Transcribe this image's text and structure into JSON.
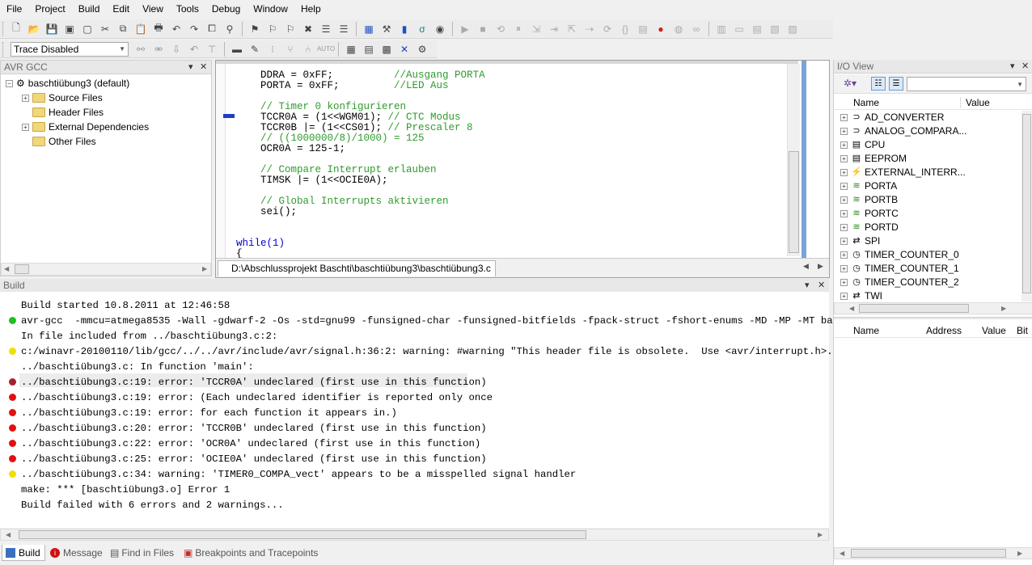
{
  "menu": [
    "File",
    "Project",
    "Build",
    "Edit",
    "View",
    "Tools",
    "Debug",
    "Window",
    "Help"
  ],
  "toolbar2": {
    "trace_combo": "Trace Disabled"
  },
  "left_panel": {
    "title": "AVR GCC",
    "project": "baschtiübung3 (default)",
    "folders": [
      "Source Files",
      "Header Files",
      "External Dependencies",
      "Other Files"
    ]
  },
  "editor": {
    "title_fragment": "D:\\Abschlussprojekt Baschti\\baschtiübung3\\baschtiübung3.c",
    "tab_label": "D:\\Abschlussprojekt Baschti\\baschtiübung3\\baschtiübung3.c",
    "lines": [
      {
        "code": "    DDRA = 0xFF;          ",
        "comment": "//Ausgang PORTA"
      },
      {
        "code": "    PORTA = 0xFF;         ",
        "comment": "//LED Aus"
      },
      {
        "code": "",
        "comment": ""
      },
      {
        "code": "    ",
        "comment": "// Timer 0 konfigurieren"
      },
      {
        "code": "    TCCR0A = (1<<WGM01); ",
        "comment": "// CTC Modus"
      },
      {
        "code": "    TCCR0B |= (1<<CS01); ",
        "comment": "// Prescaler 8"
      },
      {
        "code": "    ",
        "comment": "// ((1000000/8)/1000) = 125"
      },
      {
        "code": "    OCR0A = 125-1;",
        "comment": ""
      },
      {
        "code": "",
        "comment": ""
      },
      {
        "code": "    ",
        "comment": "// Compare Interrupt erlauben"
      },
      {
        "code": "    TIMSK |= (1<<OCIE0A);",
        "comment": ""
      },
      {
        "code": "",
        "comment": ""
      },
      {
        "code": "    ",
        "comment": "// Global Interrupts aktivieren"
      },
      {
        "code": "    sei();",
        "comment": ""
      },
      {
        "code": "",
        "comment": ""
      },
      {
        "code": "",
        "comment": ""
      },
      {
        "code": "while(1)",
        "comment": ""
      },
      {
        "code": "{",
        "comment": ""
      }
    ]
  },
  "build_panel": {
    "title": "Build",
    "lines": [
      {
        "text": "Build started 10.8.2011 at 12:46:58",
        "status": "none"
      },
      {
        "text": "avr-gcc  -mmcu=atmega8535 -Wall -gdwarf-2 -Os -std=gnu99 -funsigned-char -funsigned-bitfields -fpack-struct -fshort-enums -MD -MP -MT baschtiübu",
        "status": "ok"
      },
      {
        "text": "In file included from ../baschtiübung3.c:2:",
        "status": "none"
      },
      {
        "text": "c:/winavr-20100110/lib/gcc/../../avr/include/avr/signal.h:36:2: warning: #warning \"This header file is obsolete.  Use <avr/interrupt.h>.\"",
        "status": "warning"
      },
      {
        "text": "../baschtiübung3.c: In function 'main':",
        "status": "none"
      },
      {
        "text": "../baschtiübung3.c:19: error: 'TCCR0A' undeclared (first use in this function)",
        "status": "error-selected"
      },
      {
        "text": "../baschtiübung3.c:19: error: (Each undeclared identifier is reported only once",
        "status": "error"
      },
      {
        "text": "../baschtiübung3.c:19: error: for each function it appears in.)",
        "status": "error"
      },
      {
        "text": "../baschtiübung3.c:20: error: 'TCCR0B' undeclared (first use in this function)",
        "status": "error"
      },
      {
        "text": "../baschtiübung3.c:22: error: 'OCR0A' undeclared (first use in this function)",
        "status": "error"
      },
      {
        "text": "../baschtiübung3.c:25: error: 'OCIE0A' undeclared (first use in this function)",
        "status": "error"
      },
      {
        "text": "../baschtiübung3.c:34: warning: 'TIMER0_COMPA_vect' appears to be a misspelled signal handler",
        "status": "warning"
      },
      {
        "text": "make: *** [baschtiübung3.o] Error 1",
        "status": "none"
      },
      {
        "text": "Build failed with 6 errors and 2 warnings...",
        "status": "none"
      }
    ]
  },
  "bottom_tabs": [
    "Build",
    "Message",
    "Find in Files",
    "Breakpoints and Tracepoints"
  ],
  "io_view": {
    "title": "I/O View",
    "columns": [
      "Name",
      "Value"
    ],
    "items": [
      {
        "name": "AD_CONVERTER",
        "icon": "converter-icon"
      },
      {
        "name": "ANALOG_COMPARA...",
        "icon": "comparator-icon"
      },
      {
        "name": "CPU",
        "icon": "cpu-icon"
      },
      {
        "name": "EEPROM",
        "icon": "eeprom-icon"
      },
      {
        "name": "EXTERNAL_INTERR...",
        "icon": "interrupt-icon"
      },
      {
        "name": "PORTA",
        "icon": "port-icon"
      },
      {
        "name": "PORTB",
        "icon": "port-icon"
      },
      {
        "name": "PORTC",
        "icon": "port-icon"
      },
      {
        "name": "PORTD",
        "icon": "port-icon"
      },
      {
        "name": "SPI",
        "icon": "spi-icon"
      },
      {
        "name": "TIMER_COUNTER_0",
        "icon": "timer-icon"
      },
      {
        "name": "TIMER_COUNTER_1",
        "icon": "timer-icon"
      },
      {
        "name": "TIMER_COUNTER_2",
        "icon": "timer-icon"
      },
      {
        "name": "TWI",
        "icon": "twi-icon"
      }
    ],
    "detail_columns": [
      "Name",
      "Address",
      "Value",
      "Bit"
    ]
  },
  "colors": {
    "error": "#e01010",
    "error_selected": "#a82030",
    "warning": "#f0e000",
    "ok": "#20c020",
    "comment": "#2e9b2e",
    "keyword": "#0000cc"
  }
}
